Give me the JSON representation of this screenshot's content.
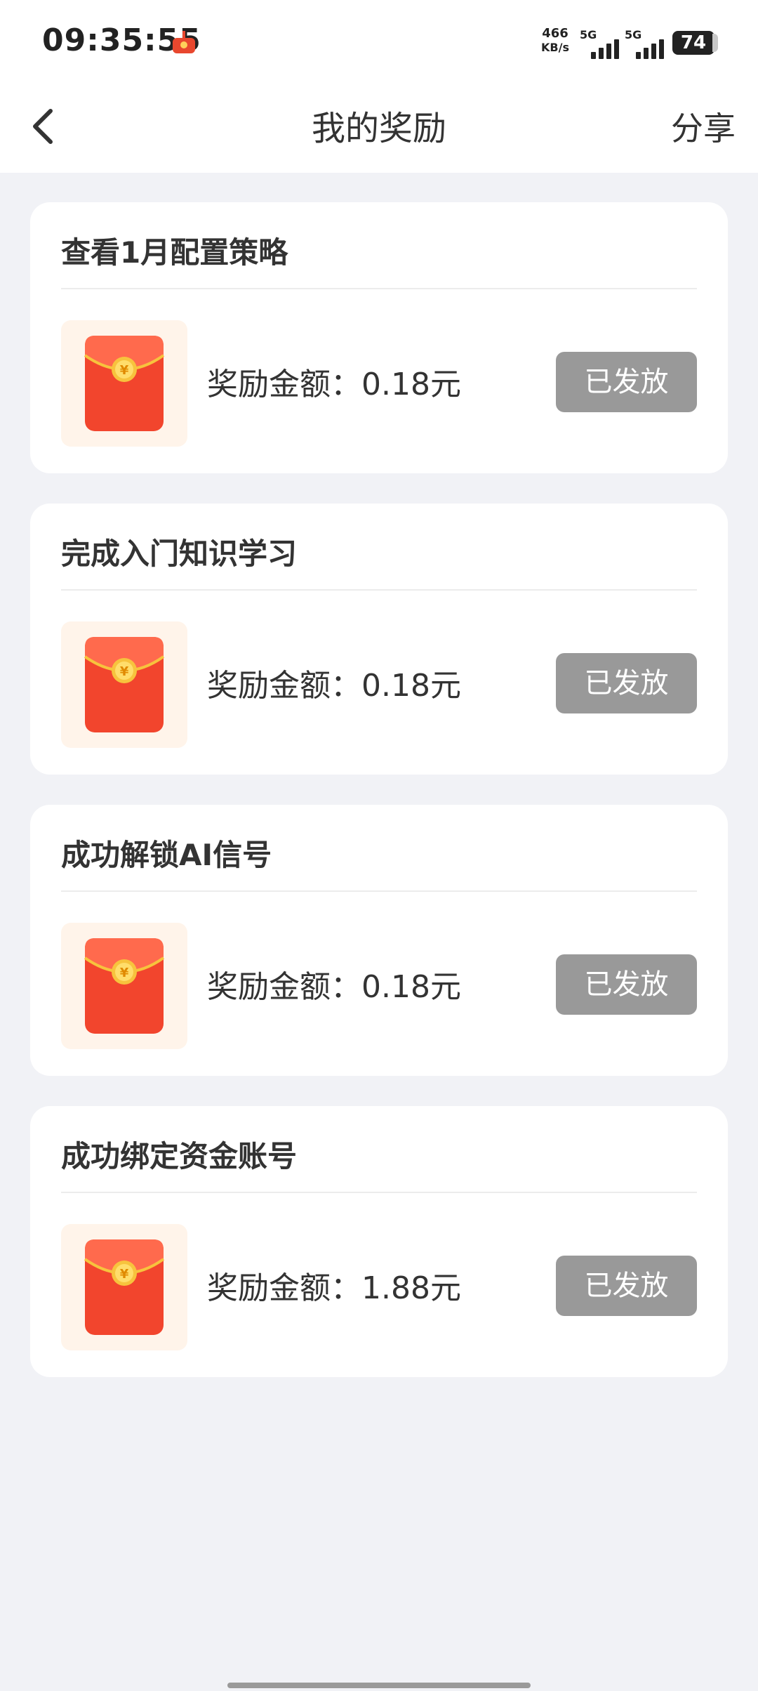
{
  "status_bar": {
    "time": "09:35:55",
    "net_speed_value": "466",
    "net_speed_unit": "KB/s",
    "sim1_tag": "5G",
    "sim2_tag": "5G",
    "battery": "74"
  },
  "header": {
    "title": "我的奖励",
    "share_label": "分享"
  },
  "rewards": [
    {
      "title": "查看1月配置策略",
      "amount_label": "奖励金额：",
      "amount": "0.18元",
      "status": "已发放"
    },
    {
      "title": "完成入门知识学习",
      "amount_label": "奖励金额：",
      "amount": "0.18元",
      "status": "已发放"
    },
    {
      "title": "成功解锁AI信号",
      "amount_label": "奖励金额：",
      "amount": "0.18元",
      "status": "已发放"
    },
    {
      "title": "成功绑定资金账号",
      "amount_label": "奖励金额：",
      "amount": "1.88元",
      "status": "已发放"
    }
  ],
  "icons": {
    "back": "chevron-left-icon",
    "reward": "red-envelope-icon",
    "status_app": "app-notification-icon"
  },
  "colors": {
    "background": "#f1f2f6",
    "card": "#ffffff",
    "status_button": "#999999",
    "envelope_red": "#f2452d",
    "coin_gold": "#f7c33d"
  }
}
